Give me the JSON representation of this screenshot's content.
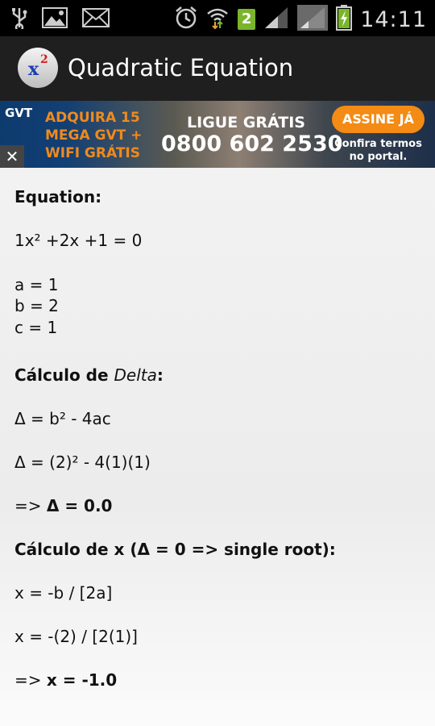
{
  "status_bar": {
    "time": "14:11",
    "sim_number": "2",
    "icons": [
      "usb-icon",
      "image-icon",
      "mail-icon",
      "alarm-icon",
      "wifi-icon",
      "sim-badge-icon",
      "signal-icon",
      "signal-icon",
      "battery-charging-icon"
    ]
  },
  "action_bar": {
    "title": "Quadratic Equation",
    "icon_base": "x",
    "icon_exponent": "2"
  },
  "ad": {
    "logo": "GVT",
    "close": "✕",
    "promo_line1": "ADQUIRA 15",
    "promo_line2": "MEGA GVT +",
    "promo_line3": "WIFI GRÁTIS",
    "ligue": "LIGUE GRÁTIS",
    "phone": "0800 602 2530",
    "cta": "ASSINE JÁ",
    "terms": "Confira termos no portal."
  },
  "content": {
    "equation_heading": "Equation:",
    "equation": "1x² +2x +1 = 0",
    "a": "a = 1",
    "b": "b = 2",
    "c": "c = 1",
    "delta_heading_prefix": "Cálculo de ",
    "delta_heading_word": "Delta",
    "delta_heading_suffix": ":",
    "delta_formula": "Δ = b² - 4ac",
    "delta_substituted": "Δ = (2)² - 4(1)(1)",
    "delta_result_prefix": "=> ",
    "delta_result": "Δ = 0.0",
    "x_heading": "Cálculo de x (Δ = 0 => single root):",
    "x_formula": "x = -b / [2a]",
    "x_substituted": "x = -(2) / [2(1)]",
    "x_result_prefix": "=> ",
    "x_result": "x = -1.0"
  }
}
